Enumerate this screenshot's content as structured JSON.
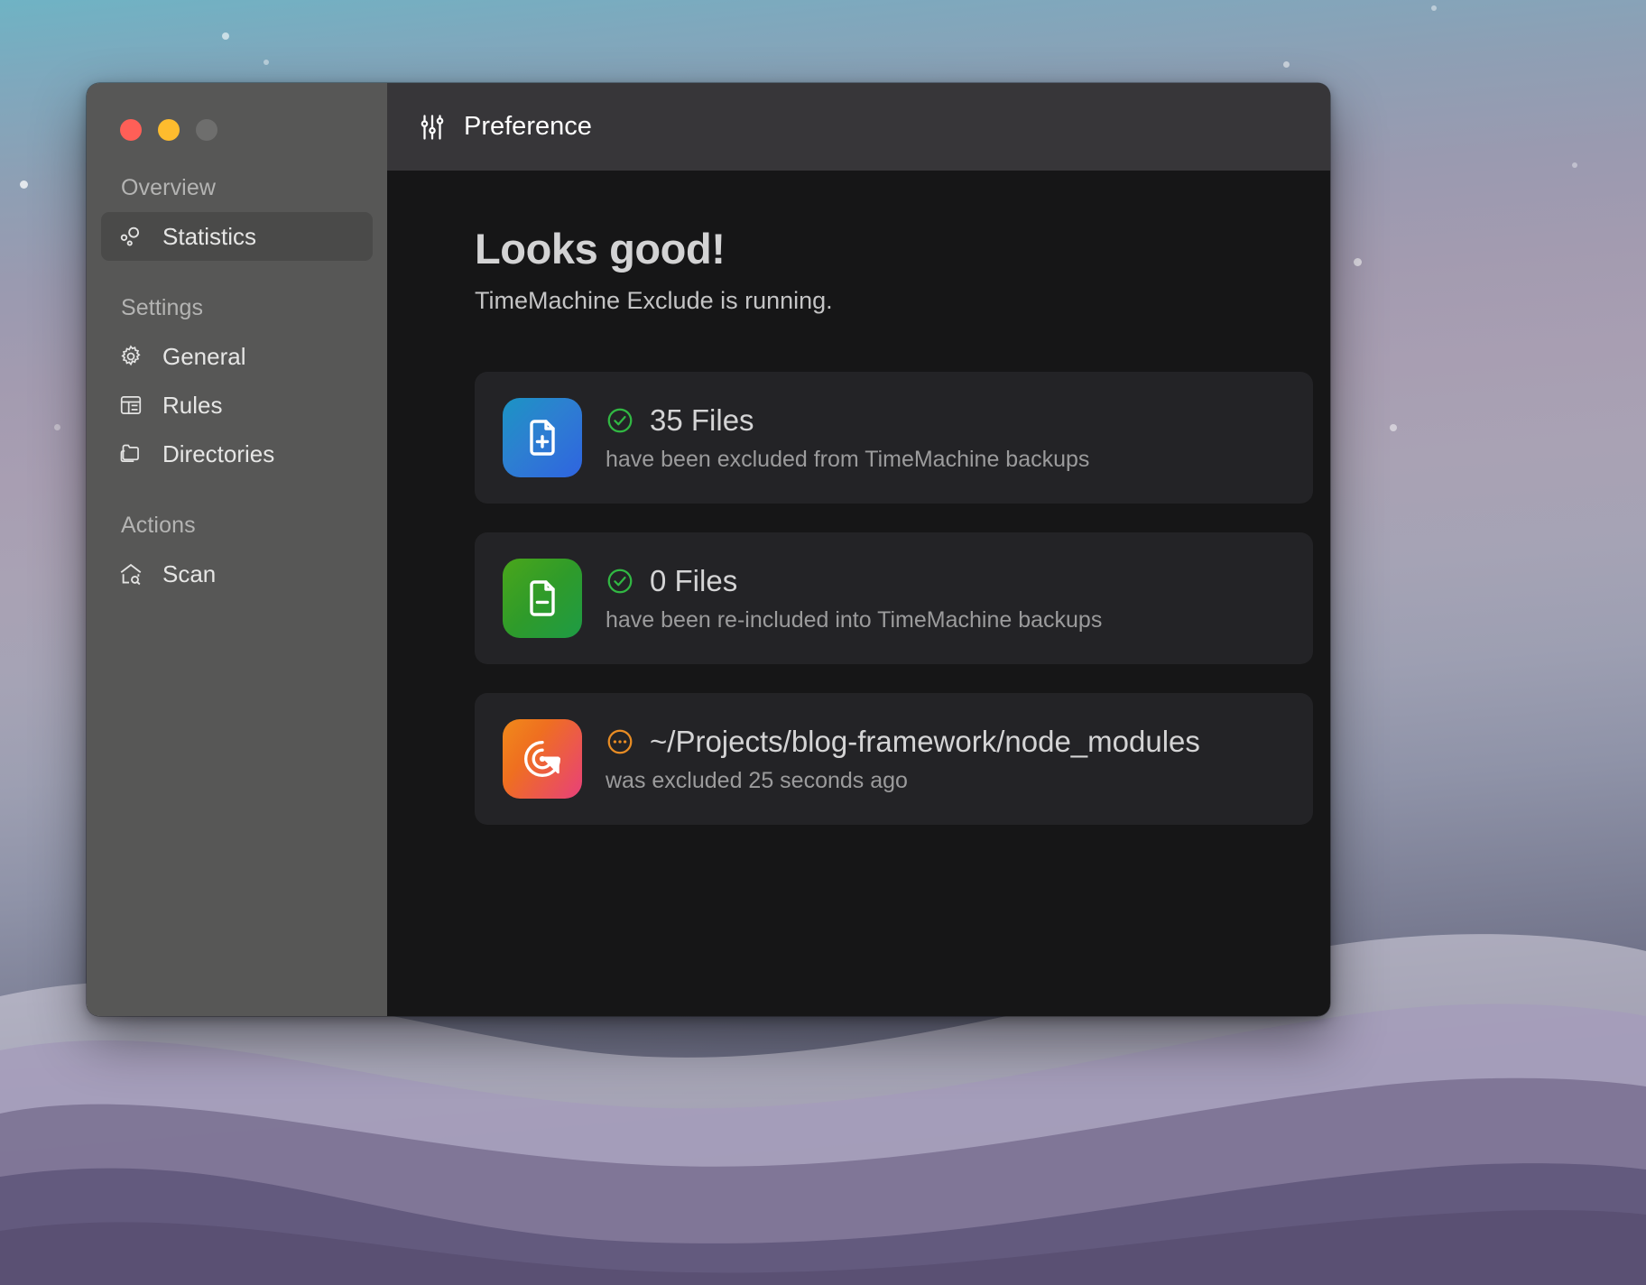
{
  "window": {
    "traffic_lights": [
      {
        "name": "close",
        "color": "#ff5f57"
      },
      {
        "name": "minimize",
        "color": "#febc2e"
      },
      {
        "name": "maximize",
        "color": "#6e6e6d"
      }
    ]
  },
  "titlebar": {
    "icon": "sliders-icon",
    "title": "Preference"
  },
  "sidebar": {
    "sections": [
      {
        "label": "Overview",
        "items": [
          {
            "label": "Statistics",
            "icon": "statistics-icon",
            "selected": true
          }
        ]
      },
      {
        "label": "Settings",
        "items": [
          {
            "label": "General",
            "icon": "gear-icon",
            "selected": false
          },
          {
            "label": "Rules",
            "icon": "rules-list-icon",
            "selected": false
          },
          {
            "label": "Directories",
            "icon": "folders-icon",
            "selected": false
          }
        ]
      },
      {
        "label": "Actions",
        "items": [
          {
            "label": "Scan",
            "icon": "house-search-icon",
            "selected": false
          }
        ]
      }
    ]
  },
  "main": {
    "headline": "Looks good!",
    "subhead": "TimeMachine Exclude is running.",
    "cards": [
      {
        "icon": "document-plus-icon",
        "icon_style": "icon-blue",
        "status_icon": "check-circle-icon",
        "status_color": "#31b843",
        "title": "35 Files",
        "subtitle": "have been excluded from TimeMachine backups"
      },
      {
        "icon": "document-minus-icon",
        "icon_style": "icon-green",
        "status_icon": "check-circle-icon",
        "status_color": "#31b843",
        "title": "0 Files",
        "subtitle": "have been re-included into TimeMachine backups"
      },
      {
        "icon": "radar-scan-icon",
        "icon_style": "icon-sunset",
        "status_icon": "ellipsis-circle-icon",
        "status_color": "#e88c24",
        "title": "~/Projects/blog-framework/node_modules",
        "subtitle": "was excluded 25 seconds ago"
      }
    ]
  },
  "colors": {
    "sidebar_bg": "#575756",
    "sidebar_selected": "#4a4a49",
    "titlebar_bg": "#373639",
    "content_bg": "#161617",
    "card_bg": "#232326",
    "accent_green": "#31b843",
    "accent_orange": "#e88c24"
  }
}
